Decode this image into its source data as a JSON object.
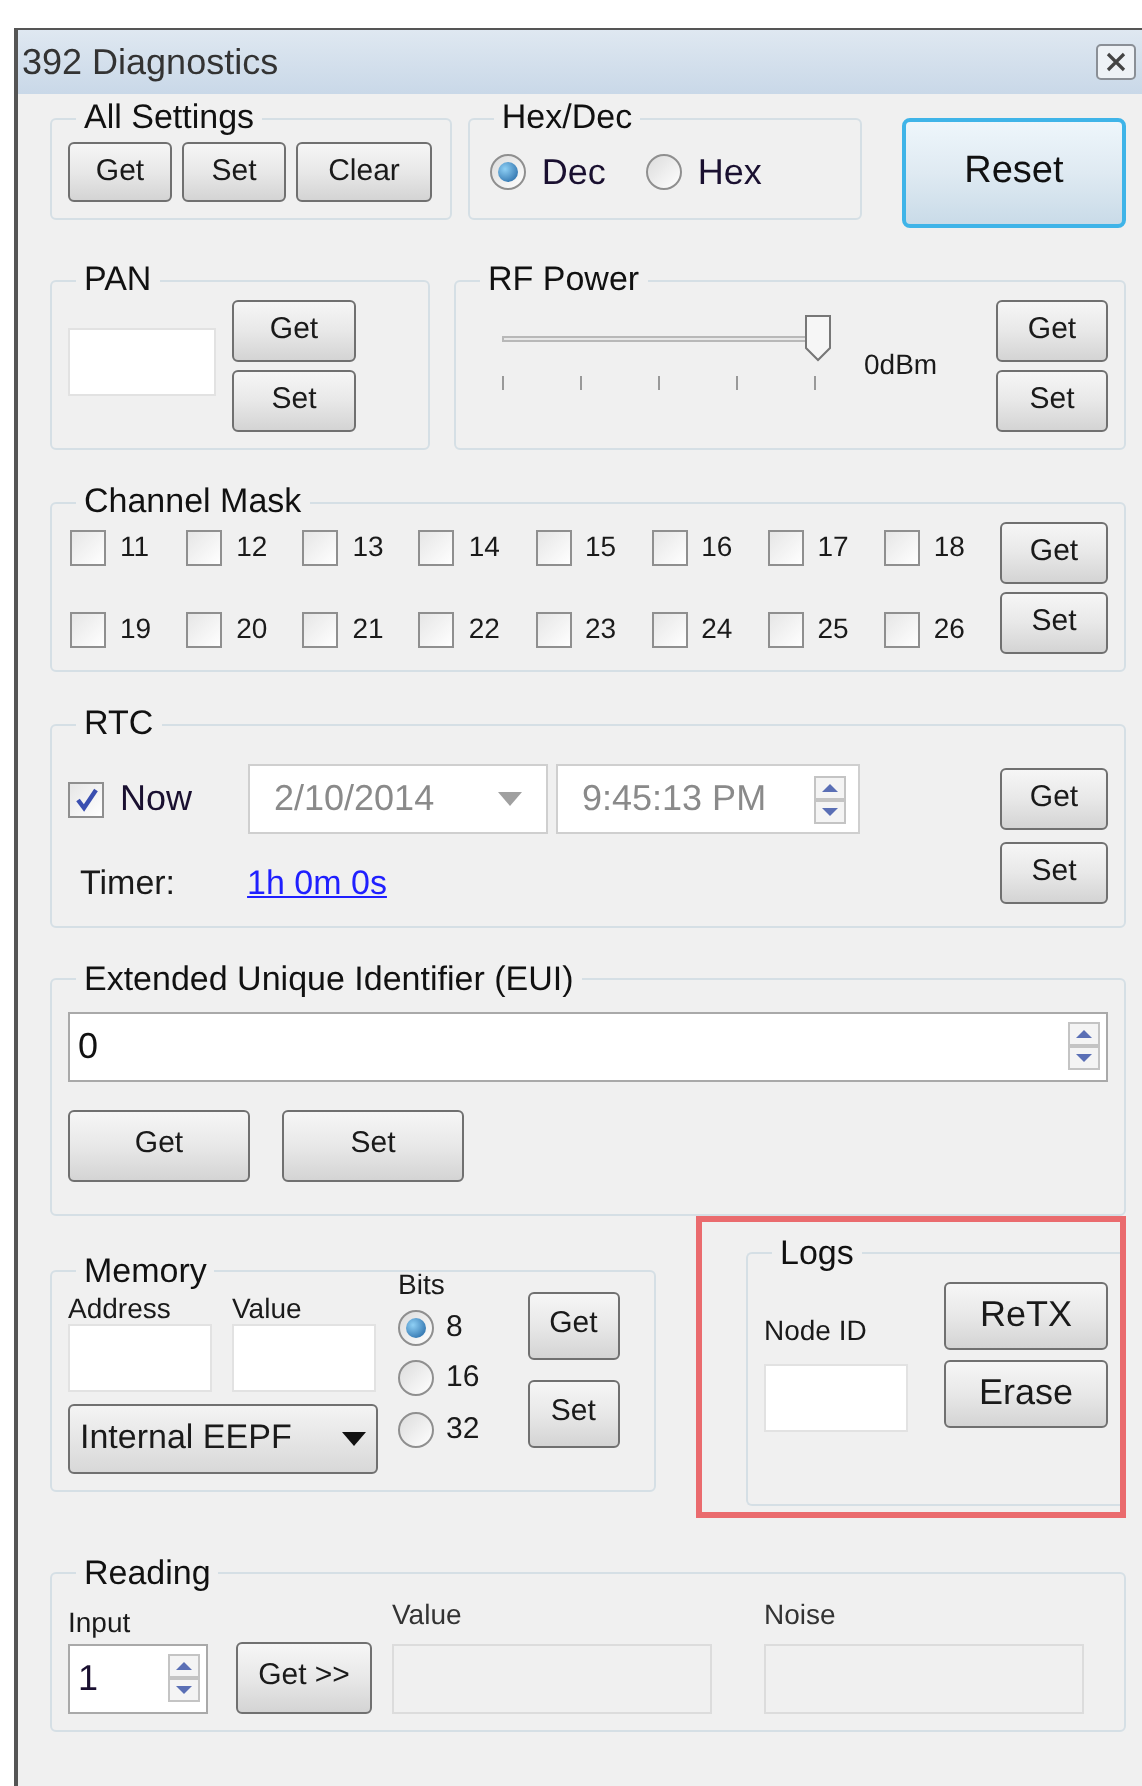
{
  "window": {
    "title": "392 Diagnostics"
  },
  "all_settings": {
    "title": "All Settings",
    "buttons": [
      "Get",
      "Set",
      "Clear"
    ]
  },
  "hex_dec": {
    "title": "Hex/Dec",
    "options": [
      {
        "label": "Dec",
        "selected": true
      },
      {
        "label": "Hex",
        "selected": false
      }
    ]
  },
  "reset_button": "Reset",
  "pan": {
    "title": "PAN",
    "buttons": [
      "Get",
      "Set"
    ]
  },
  "rf_power": {
    "title": "RF Power",
    "level": 1,
    "reading": "0dBm",
    "buttons": [
      "Get",
      "Set"
    ]
  },
  "channel_mask": {
    "title": "Channel Mask",
    "channels": [
      {
        "label": "11",
        "checked": false
      },
      {
        "label": "12",
        "checked": false
      },
      {
        "label": "13",
        "checked": false
      },
      {
        "label": "14",
        "checked": false
      },
      {
        "label": "15",
        "checked": false
      },
      {
        "label": "16",
        "checked": false
      },
      {
        "label": "17",
        "checked": false
      },
      {
        "label": "18",
        "checked": false
      },
      {
        "label": "19",
        "checked": false
      },
      {
        "label": "20",
        "checked": false
      },
      {
        "label": "21",
        "checked": false
      },
      {
        "label": "22",
        "checked": false
      },
      {
        "label": "23",
        "checked": false
      },
      {
        "label": "24",
        "checked": false
      },
      {
        "label": "25",
        "checked": false
      },
      {
        "label": "26",
        "checked": false
      }
    ],
    "buttons": [
      "Get",
      "Set"
    ]
  },
  "rtc": {
    "title": "RTC",
    "now": {
      "label": "Now",
      "checked": true
    },
    "date": {
      "value": "2/10/2014",
      "disabled": true
    },
    "time": {
      "value": "9:45:13 PM",
      "disabled": true
    },
    "timer_label": "Timer:",
    "timer_link": "1h 0m 0s",
    "buttons": [
      "Get",
      "Set"
    ]
  },
  "eui": {
    "title": "Extended Unique Identifier (EUI)",
    "value": "0",
    "buttons": [
      "Get",
      "Set"
    ]
  },
  "memory": {
    "title": "Memory",
    "address_label": "Address",
    "value_label": "Value",
    "bits_label": "Bits",
    "bits": [
      {
        "label": "8",
        "selected": true
      },
      {
        "label": "16",
        "selected": false
      },
      {
        "label": "32",
        "selected": false
      }
    ],
    "dropdown": "Internal EEPF",
    "buttons": [
      "Get",
      "Set"
    ]
  },
  "logs": {
    "title": "Logs",
    "node_id_label": "Node ID",
    "buttons": [
      "ReTX",
      "Erase"
    ]
  },
  "reading": {
    "title": "Reading",
    "input_label": "Input",
    "input_value": "1",
    "button": "Get >>",
    "value_label": "Value",
    "noise_label": "Noise"
  }
}
